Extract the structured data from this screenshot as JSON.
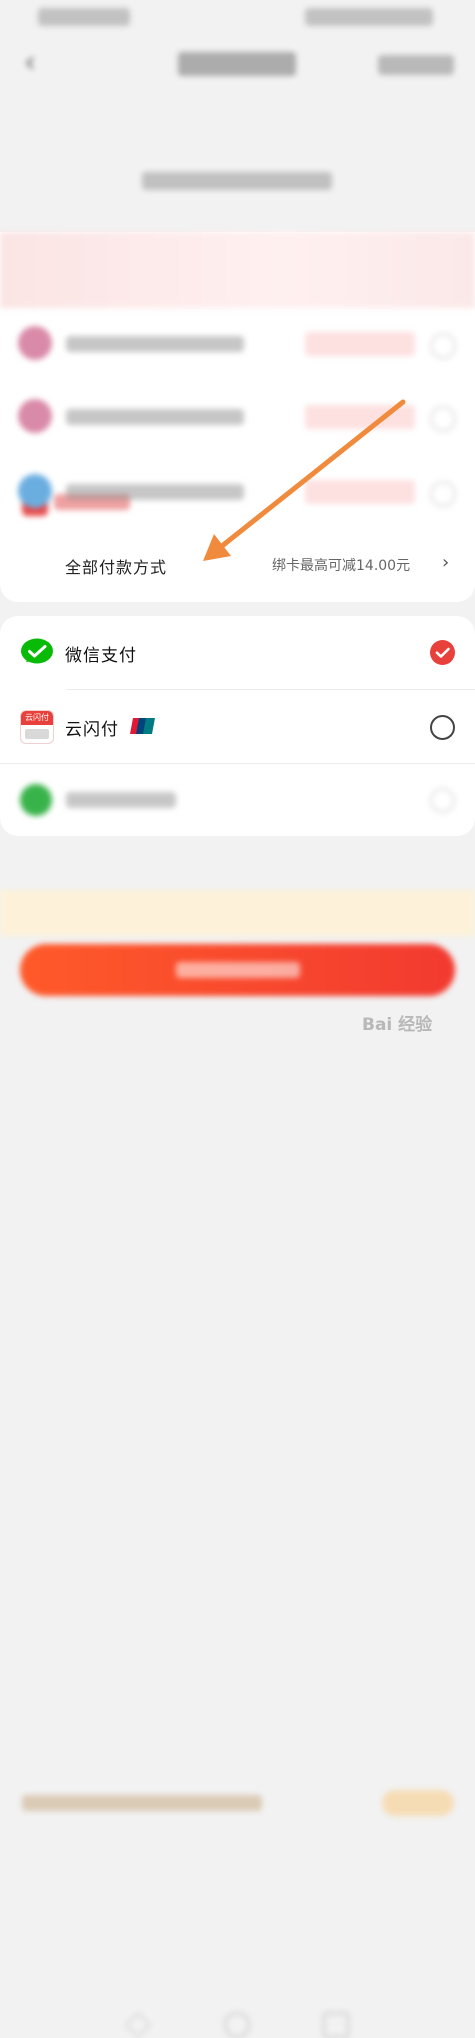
{
  "payment_options": {
    "all_methods_label": "全部付款方式",
    "bind_card_discount": "绑卡最高可减14.00元",
    "chevron": "›"
  },
  "methods": [
    {
      "label": "微信支付",
      "icon": "wechat-icon",
      "selected": true
    },
    {
      "label": "云闪付",
      "icon": "unionpay-quickpass-icon",
      "icon_text": "云闪付",
      "selected": false
    }
  ],
  "header": {
    "back_icon": "‹"
  },
  "watermark": "Bai 经验",
  "colors": {
    "accent": "#e8403a",
    "wechat": "#09bb07",
    "arrow": "#f08a3c"
  }
}
